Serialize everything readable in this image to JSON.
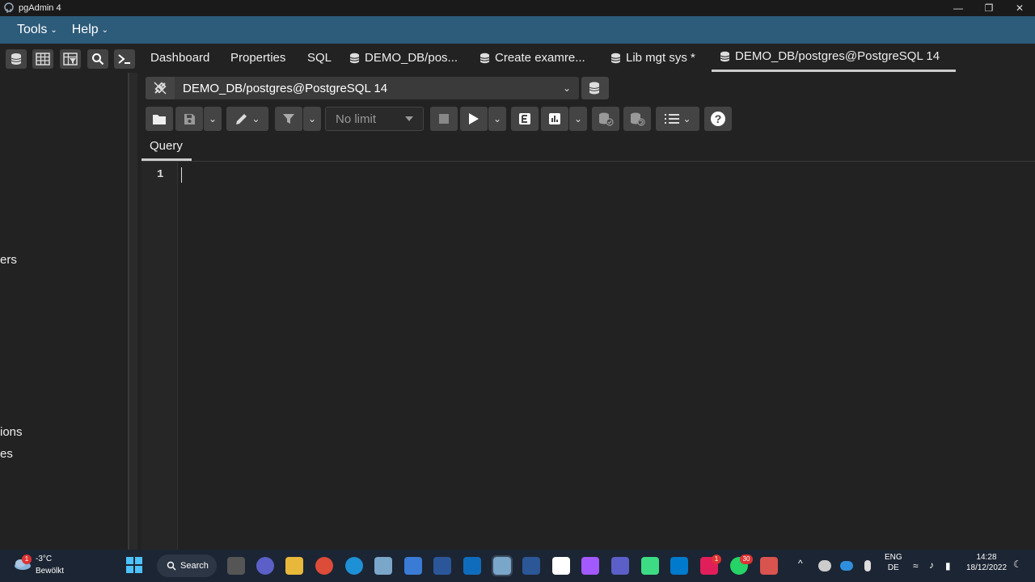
{
  "window": {
    "title": "pgAdmin 4"
  },
  "menubar": {
    "items": [
      {
        "label": "Tools"
      },
      {
        "label": "Help"
      }
    ]
  },
  "tabs": [
    {
      "label": "Dashboard"
    },
    {
      "label": "Properties"
    },
    {
      "label": "SQL"
    },
    {
      "label": "DEMO_DB/pos..."
    },
    {
      "label": "Create examre..."
    },
    {
      "label": "Lib mgt sys *"
    },
    {
      "label": "DEMO_DB/postgres@PostgreSQL 14",
      "active": true
    }
  ],
  "left_pane": {
    "fragments": [
      "ers",
      "ions",
      "es"
    ]
  },
  "query_tool": {
    "connection": "DEMO_DB/postgres@PostgreSQL 14",
    "limit_select": "No limit",
    "editor_tab": "Query",
    "line_numbers": [
      "1"
    ]
  },
  "taskbar": {
    "weather_temp": "-3°C",
    "weather_desc": "Bewölkt",
    "search_label": "Search",
    "language": "ENG",
    "region": "DE",
    "time": "14:28",
    "date": "18/12/2022",
    "weather_badge": "1",
    "slack_badge": "1",
    "whatsapp_badge": "30"
  },
  "colors": {
    "menubar_bg": "#2d5b7a",
    "background": "#222222",
    "taskbar_bg": "#1c2533"
  }
}
